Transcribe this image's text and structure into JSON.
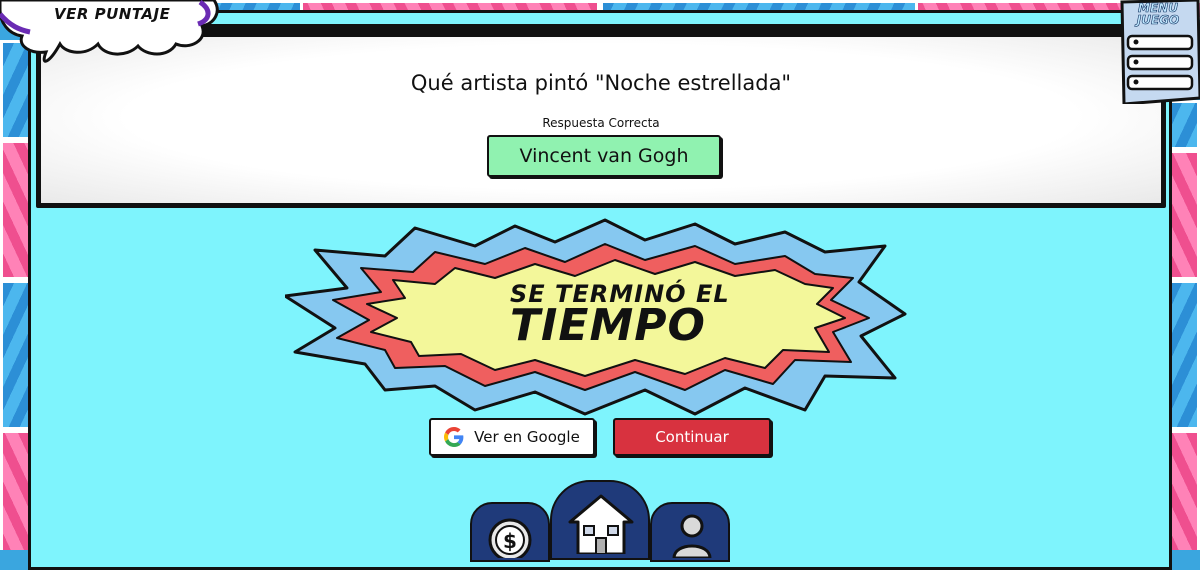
{
  "score_button": {
    "label": "VER PUNTAJE"
  },
  "menu_button": {
    "label_line1": "MENU",
    "label_line2": "JUEGO"
  },
  "question": {
    "text": "Qué artista pintó \"Noche estrellada\"",
    "answer_label": "Respuesta Correcta",
    "answer": "Vincent van Gogh"
  },
  "banner": {
    "line1": "SE TERMINÓ EL",
    "line2": "TIEMPO"
  },
  "actions": {
    "google_label": "Ver en Google",
    "continue_label": "Continuar"
  },
  "bottom_nav": {
    "items": [
      "coin-icon",
      "house-icon",
      "person-icon"
    ]
  },
  "colors": {
    "frame_bg": "#7ef4fd",
    "answer_bg": "#90f2b0",
    "continue_bg": "#d8323f",
    "nav_bg": "#1f3a7a",
    "burst_center": "#f3f79a",
    "burst_red": "#ef5f5f",
    "burst_blue": "#86c8f0"
  }
}
